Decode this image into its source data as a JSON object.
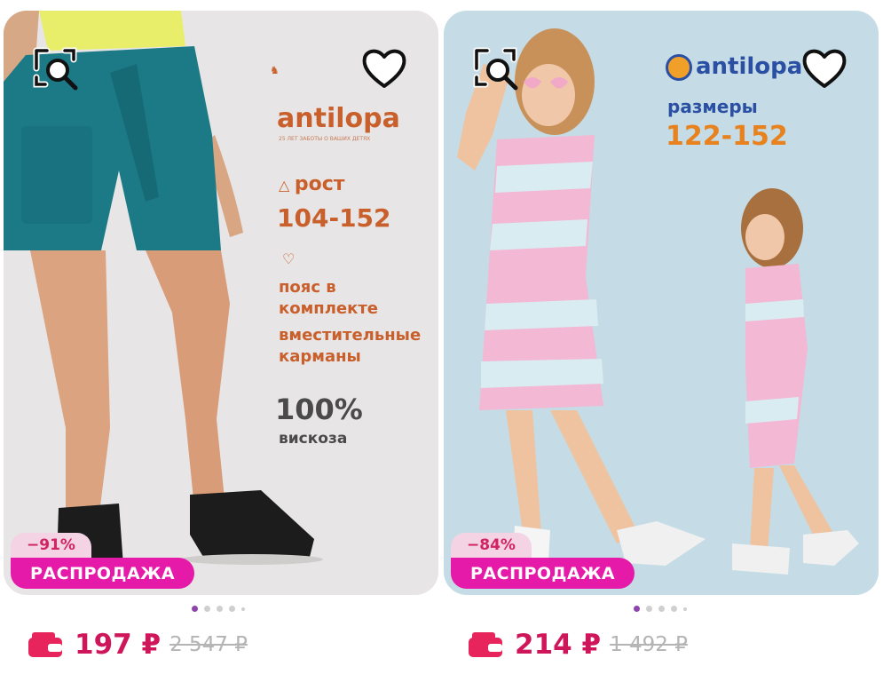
{
  "products": [
    {
      "promo_brand": "antilopa",
      "promo_tagline": "25 ЛЕТ ЗАБОТЫ О ВАШИХ ДЕТЯХ",
      "promo_height_label": "рост",
      "promo_height_range": "104-152",
      "promo_feature_1": "пояс в комплекте",
      "promo_feature_2": "вместительные карманы",
      "promo_fabric_percent": "100%",
      "promo_fabric": "вискоза",
      "discount": "−91%",
      "badge": "РАСПРОДАЖА",
      "price": "197 ₽",
      "old_price": "2 547 ₽"
    },
    {
      "promo_brand": "antilopa",
      "promo_sizes_label": "размеры",
      "promo_sizes_range": "122-152",
      "discount": "−84%",
      "badge": "РАСПРОДАЖА",
      "price": "214 ₽",
      "old_price": "1 492 ₽"
    }
  ],
  "colors": {
    "price": "#d0165b",
    "sale_badge": "#e51aa8",
    "discount_bg": "#f3d3e4",
    "promo_orange": "#c9602c",
    "promo_blue": "#2b4fa3"
  },
  "icons": [
    "image-search-icon",
    "heart-outline-icon",
    "wallet-icon"
  ]
}
